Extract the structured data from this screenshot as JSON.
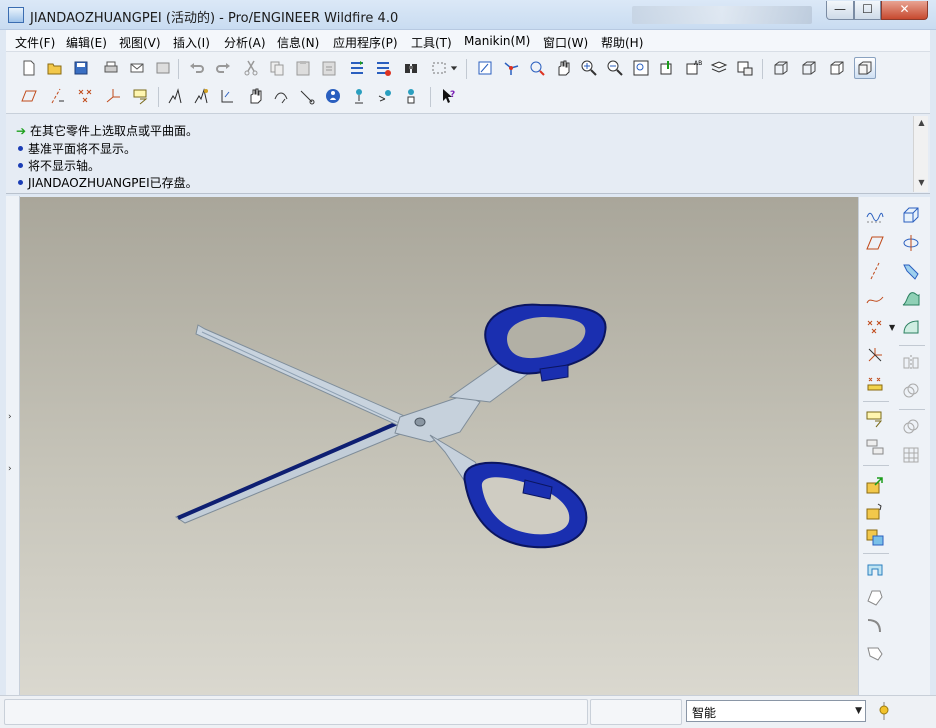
{
  "window": {
    "title": "JIANDAOZHUANGPEI (活动的) - Pro/ENGINEER Wildfire 4.0",
    "controls": {
      "minimize": "—",
      "maximize": "☐",
      "close": "✕"
    }
  },
  "menu": {
    "items": [
      "文件(F)",
      "编辑(E)",
      "视图(V)",
      "插入(I)",
      "分析(A)",
      "信息(N)",
      "应用程序(P)",
      "工具(T)",
      "Manikin(M)",
      "窗口(W)",
      "帮助(H)"
    ]
  },
  "toolbar": {
    "row1": [
      "new-icon",
      "open-icon",
      "save-icon",
      "print-icon",
      "send-icon",
      "close-window-icon",
      "undo-icon",
      "redo-icon",
      "cut-icon",
      "copy-icon",
      "paste-icon",
      "paste-special-icon",
      "regenerate-icon",
      "regen-manager-icon",
      "find-icon",
      "select-box-icon",
      "dropdown-icon",
      "repaint-icon",
      "spin-center-icon",
      "orient-mode-icon",
      "pan-icon",
      "zoom-in-icon",
      "zoom-out-icon",
      "refit-icon",
      "reorient-icon",
      "saved-views-icon",
      "layers-icon",
      "view-manager-icon",
      "wireframe-icon",
      "hidden-line-icon",
      "no-hidden-icon",
      "shading-icon"
    ],
    "row2": [
      "datum-plane-display-icon",
      "datum-axis-display-icon",
      "datum-point-display-icon",
      "datum-csys-display-icon",
      "annotation-display-icon",
      "assembly-component-icon",
      "assembly-package-icon",
      "mech-icon",
      "hand-icon",
      "reach-icon",
      "vision-icon",
      "manikin-create-icon",
      "manikin-posture-icon",
      "manikin-view-icon",
      "manikin-info-icon",
      "context-help-icon"
    ]
  },
  "messages": [
    {
      "type": "prompt",
      "text": "在其它零件上选取点或平曲面。"
    },
    {
      "type": "info",
      "text": "基准平面将不显示。"
    },
    {
      "type": "info",
      "text": "将不显示轴。"
    },
    {
      "type": "info",
      "text": "JIANDAOZHUANGPEI已存盘。"
    }
  ],
  "right_toolbar": {
    "col1": [
      "sketch-tool-icon",
      "datum-plane-icon",
      "datum-axis-icon",
      "datum-curve-icon",
      "datum-point-icon",
      "datum-csys-icon",
      "analysis-feature-icon",
      "add-component-icon",
      "package-component-icon",
      "assemble-icon",
      "create-component-icon",
      "flip-icon",
      "sweep-icon",
      "round-icon",
      "chamfer-icon"
    ],
    "col2": [
      "extrude-icon",
      "revolve-icon",
      "variable-sweep-icon",
      "blend-icon",
      "boundary-blend-icon",
      "mirror-icon",
      "merge-icon",
      "trim-icon",
      "pattern-icon"
    ]
  },
  "status": {
    "filter_value": "智能",
    "filter_arrow": "▼"
  },
  "colors": {
    "handle_blue": "#1a2fb0",
    "blade": "#bcc9d4",
    "viewport_top": "#a9a69a",
    "viewport_bottom": "#dad8cf"
  }
}
